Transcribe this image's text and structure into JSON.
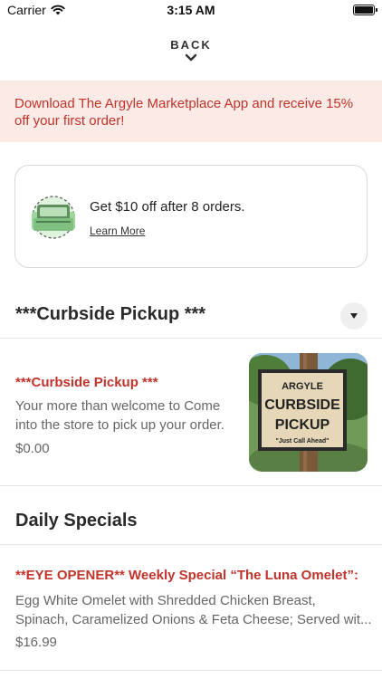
{
  "status_bar": {
    "carrier": "Carrier",
    "time": "3:15 AM",
    "wifi_icon": "wifi-icon",
    "battery_icon": "battery-icon"
  },
  "back": {
    "label": "BACK",
    "icon": "chevron-down-icon"
  },
  "promo_banner": {
    "text": "Download The Argyle Marketplace App and receive 15% off your first order!"
  },
  "reward_card": {
    "icon": "punch-card-icon",
    "title": "Get $10 off after 8 orders.",
    "link": "Learn More"
  },
  "sections": [
    {
      "title": "***Curbside Pickup ***",
      "toggle_icon": "caret-down-icon",
      "items": [
        {
          "name": "***Curbside Pickup ***",
          "description": "Your more than welcome  to Come into the store to pick up your order.",
          "price": "$0.00",
          "photo_sign": {
            "line1": "ARGYLE",
            "line2": "CURBSIDE",
            "line3": "PICKUP",
            "line4": "\"Just Call Ahead\""
          }
        }
      ]
    },
    {
      "title": "Daily Specials",
      "items": [
        {
          "name": "**EYE OPENER** Weekly Special   “The Luna Omelet”:",
          "description_line1": "Egg White Omelet with Shredded Chicken Breast,",
          "description_line2": "Spinach, Caramelized Onions & Feta Cheese; Served wit...",
          "price": "$16.99"
        }
      ]
    }
  ],
  "colors": {
    "accent": "#c0342b",
    "banner_bg": "#fbeae6",
    "muted_text": "#666666",
    "divider": "#e6e6e6"
  }
}
